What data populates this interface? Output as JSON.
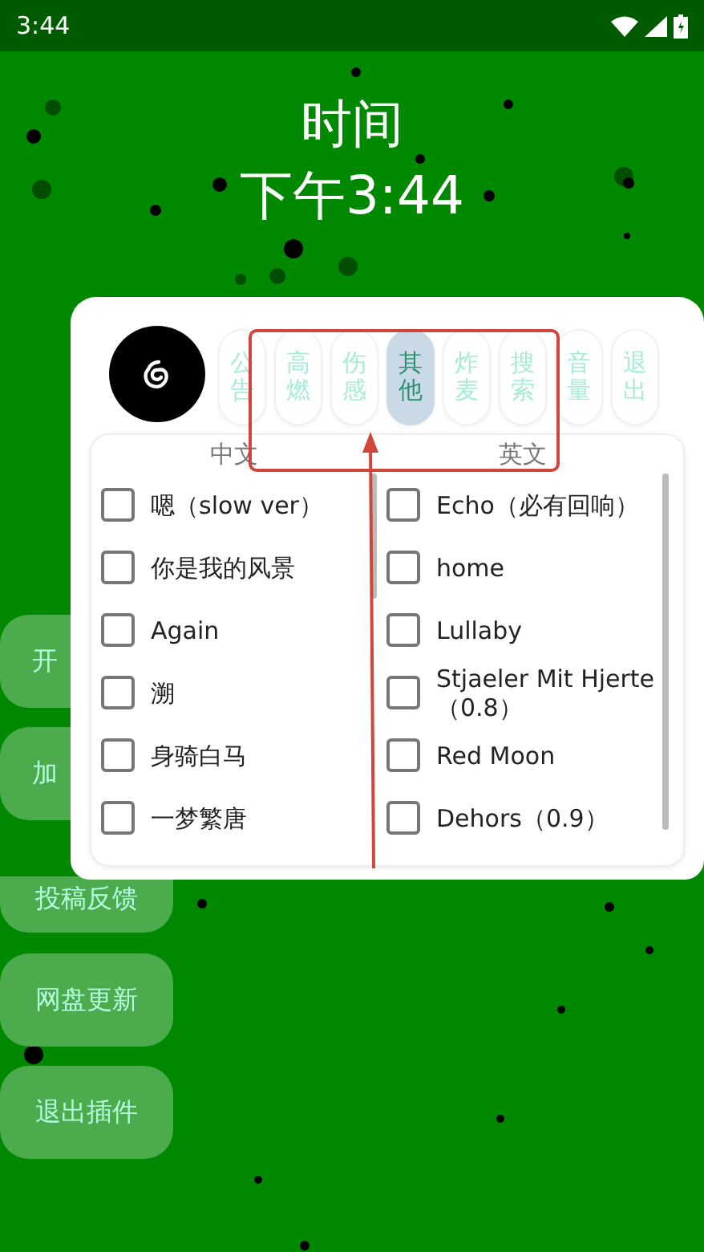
{
  "status_bar": {
    "time": "3:44"
  },
  "header": {
    "title": "时间",
    "clock": "下午3:44"
  },
  "side_buttons": [
    "开",
    "加",
    "投稿反馈",
    "网盘更新",
    "退出插件"
  ],
  "tabs": [
    {
      "label": "公告",
      "selected": false
    },
    {
      "label": "高燃",
      "selected": false
    },
    {
      "label": "伤感",
      "selected": false
    },
    {
      "label": "其他",
      "selected": true
    },
    {
      "label": "炸麦",
      "selected": false
    },
    {
      "label": "搜索",
      "selected": false
    },
    {
      "label": "音量",
      "selected": false
    },
    {
      "label": "退出",
      "selected": false
    }
  ],
  "columns": [
    {
      "heading": "中文",
      "items": [
        {
          "label": "嗯（slow ver）",
          "checked": false
        },
        {
          "label": "你是我的风景",
          "checked": false
        },
        {
          "label": "Again",
          "checked": false
        },
        {
          "label": "溯",
          "checked": false
        },
        {
          "label": "身骑白马",
          "checked": false
        },
        {
          "label": "一梦繁唐",
          "checked": false
        }
      ]
    },
    {
      "heading": "英文",
      "items": [
        {
          "label": "Echo（必有回响）",
          "checked": false
        },
        {
          "label": "home",
          "checked": false
        },
        {
          "label": "Lullaby",
          "checked": false
        },
        {
          "label": "Stjaeler Mit Hjerte（0.8）",
          "checked": false
        },
        {
          "label": "Red Moon",
          "checked": false
        },
        {
          "label": "Dehors（0.9）",
          "checked": false
        }
      ]
    }
  ]
}
